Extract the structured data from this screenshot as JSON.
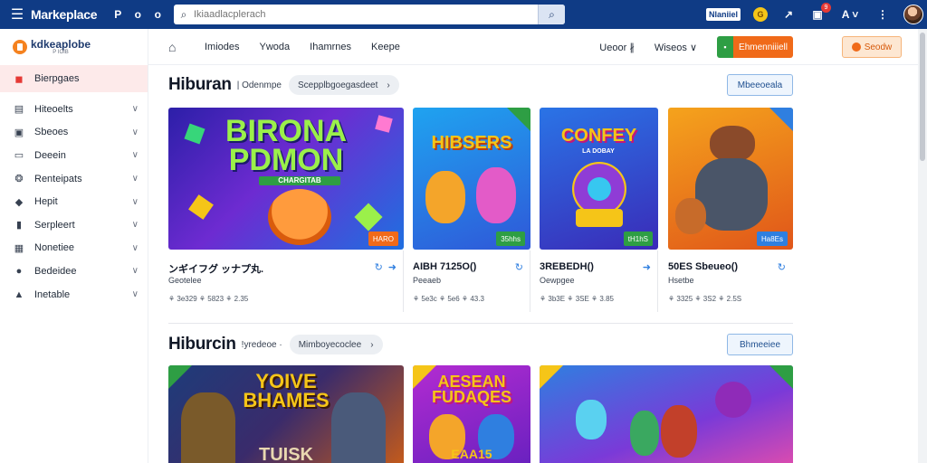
{
  "topbar": {
    "brand": "Markeplace",
    "left_icons": [
      "P",
      "o",
      "o"
    ],
    "search_placeholder": "Ikiaadlacplerach",
    "pill_text": "Nlaniiel",
    "coin_label": "G",
    "badge_count": "9",
    "colors": {
      "bg": "#0f3b85"
    }
  },
  "sidebar": {
    "logo_text": "kdkeaplobe",
    "logo_sub": "P  IOIB",
    "items": [
      {
        "label": "Bierpgaes",
        "icon": "home-icon",
        "active": true
      },
      {
        "label": "Hiteoelts",
        "icon": "list-icon"
      },
      {
        "label": "Sbeoes",
        "icon": "store-icon"
      },
      {
        "label": "Deeein",
        "icon": "device-icon"
      },
      {
        "label": "Renteipats",
        "icon": "chat-icon"
      },
      {
        "label": "Hepit",
        "icon": "tag-icon"
      },
      {
        "label": "Serpleert",
        "icon": "book-icon"
      },
      {
        "label": "Nonetiee",
        "icon": "grid-icon"
      },
      {
        "label": "Bedeidee",
        "icon": "user-icon"
      },
      {
        "label": "Inetable",
        "icon": "alert-icon"
      }
    ]
  },
  "subnav": {
    "links": [
      "Imiodes",
      "Ywoda",
      "Ihamrnes",
      "Keepe"
    ],
    "dropdown1": "Ueoor ∦",
    "dropdown2": "Wiseos ∨",
    "green_btn": "Ehmenniiiell",
    "orange_btn": "Seodw"
  },
  "sections": [
    {
      "title": "Hiburan",
      "sub": "| Odenmpe",
      "pill": "Scepplbgoegasdeet",
      "view_btn": "Mbeeoeala",
      "cards": [
        {
          "art_title": "BIRONA PDMON",
          "art_sub": "CHARGITAB",
          "tag": "HARO",
          "title": "ンギイフグ ッナプ丸.",
          "pub": "Geotelee",
          "meta": "⚘ 3e329 ⚘ 5823 ⚘ 2.35"
        },
        {
          "art_title": "HIBSERS",
          "tag": "35hhs",
          "title": "AIBH 7125O()",
          "pub": "Peeaeb",
          "meta": "⚘ 5e3c ⚘ 5e6 ⚘ 43.3"
        },
        {
          "art_title": "CONFEY",
          "art_sub": "LA DOBAY",
          "tag": "tH1hS",
          "title": "3REBEDH()",
          "pub": "Oewpgee",
          "meta": "⚘ 3b3E ⚘ 3SE ⚘ 3.85"
        },
        {
          "art_title": "",
          "tag": "Ha8Es",
          "title": "50ES Sbeueo()",
          "pub": "Hsetbe",
          "meta": "⚘ 3325 ⚘ 3S2 ⚘ 2.5S"
        }
      ]
    },
    {
      "title": "Hiburcin",
      "sub": "!yredeoe ·",
      "pill": "Mimboyecoclee",
      "view_btn": "Bhmeeiee",
      "cards": [
        {
          "art_title": "YOIVE BHAMES",
          "art_sub": "TUISK"
        },
        {
          "art_title": "AESEAN FUDAQES",
          "art_sub": "EAA15"
        },
        {
          "art_title": ""
        }
      ]
    }
  ]
}
